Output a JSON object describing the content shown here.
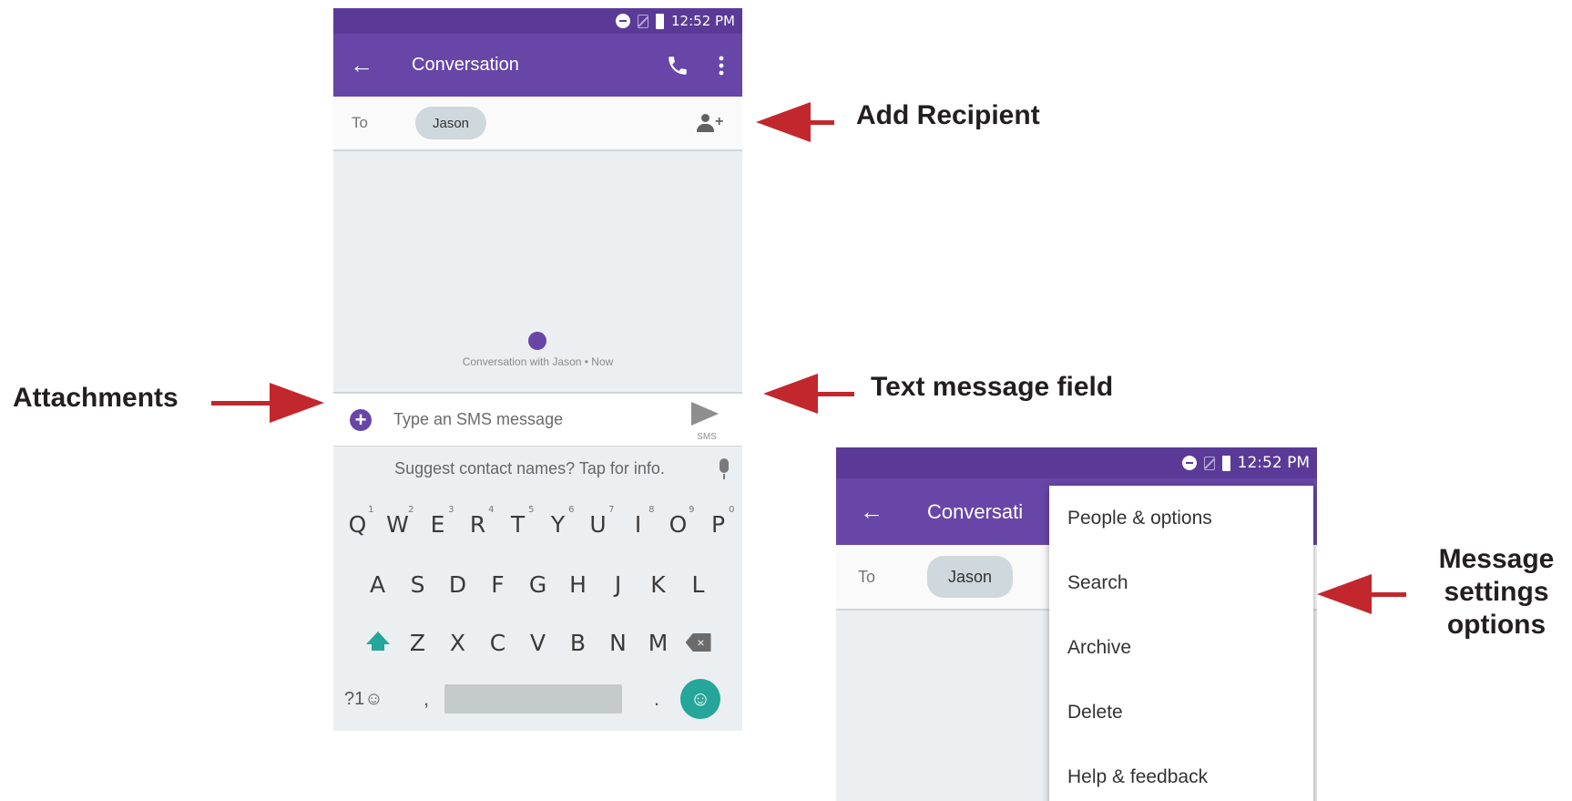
{
  "phone_main": {
    "status": {
      "time": "12:52 PM"
    },
    "toolbar": {
      "back_icon": "arrow-left-icon",
      "title": "Conversation",
      "call_icon": "phone-icon",
      "more_icon": "more-vert-icon"
    },
    "recipients": {
      "to_label": "To",
      "chip_label": "Jason",
      "add_icon": "add-person-icon"
    },
    "conversation": {
      "status_text": "Conversation with Jason • Now"
    },
    "compose": {
      "attach_icon": "plus-circle-icon",
      "placeholder": "Type an SMS message",
      "send_icon": "send-icon",
      "send_label": "SMS"
    },
    "suggestion": {
      "text": "Suggest contact names? Tap for info.",
      "mic_icon": "mic-icon"
    },
    "keyboard": {
      "row1": [
        {
          "key": "Q",
          "hint": "1"
        },
        {
          "key": "W",
          "hint": "2"
        },
        {
          "key": "E",
          "hint": "3"
        },
        {
          "key": "R",
          "hint": "4"
        },
        {
          "key": "T",
          "hint": "5"
        },
        {
          "key": "Y",
          "hint": "6"
        },
        {
          "key": "U",
          "hint": "7"
        },
        {
          "key": "I",
          "hint": "8"
        },
        {
          "key": "O",
          "hint": "9"
        },
        {
          "key": "P",
          "hint": "0"
        }
      ],
      "row2": [
        "A",
        "S",
        "D",
        "F",
        "G",
        "H",
        "J",
        "K",
        "L"
      ],
      "row3": [
        "Z",
        "X",
        "C",
        "V",
        "B",
        "N",
        "M"
      ],
      "symbols_key": "?1☺",
      "comma_key": ",",
      "period_key": ".",
      "emoji_icon": "emoji-icon"
    }
  },
  "phone_menu": {
    "status": {
      "time": "12:52 PM"
    },
    "toolbar": {
      "back_icon": "arrow-left-icon",
      "title": "Conversati"
    },
    "recipients": {
      "to_label": "To",
      "chip_label": "Jason"
    },
    "menu_items": [
      "People & options",
      "Search",
      "Archive",
      "Delete",
      "Help & feedback"
    ]
  },
  "annotations": {
    "add_recipient": "Add Recipient",
    "text_message_field": "Text message field",
    "attachments": "Attachments",
    "message_settings": [
      "Message",
      "settings",
      "options"
    ]
  },
  "colors": {
    "status_bar": "#5a3a96",
    "toolbar": "#6746a8",
    "accent_teal": "#26a69a",
    "arrow_red": "#c1272d"
  }
}
